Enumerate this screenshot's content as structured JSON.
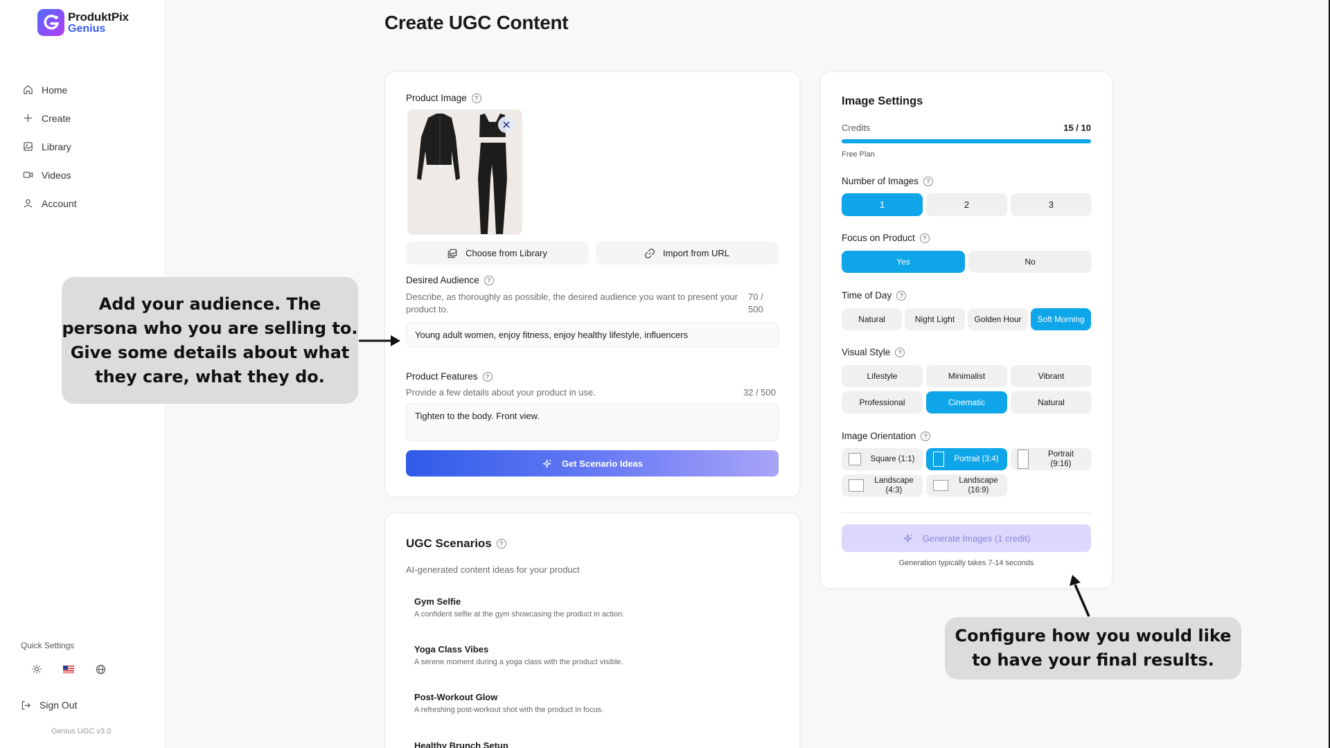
{
  "app": {
    "name": "ProduktPix",
    "subname": "Genius",
    "version": "Genius UGC v3.0"
  },
  "sidebar": {
    "items": [
      {
        "label": "Home",
        "icon": "home-icon"
      },
      {
        "label": "Create",
        "icon": "plus-icon"
      },
      {
        "label": "Library",
        "icon": "image-icon"
      },
      {
        "label": "Videos",
        "icon": "video-icon"
      },
      {
        "label": "Account",
        "icon": "user-icon"
      }
    ],
    "quick_settings_label": "Quick Settings",
    "sign_out": "Sign Out"
  },
  "page": {
    "title": "Create UGC Content"
  },
  "product_card": {
    "product_image_label": "Product Image",
    "choose_library": "Choose from Library",
    "import_url": "Import from URL",
    "audience_label": "Desired Audience",
    "audience_hint": "Describe, as thoroughly as possible, the desired audience you want to present your product to.",
    "audience_count_top": "70 /",
    "audience_count_bottom": "500",
    "audience_value": "Young adult women, enjoy fitness, enjoy healthy lifestyle, influencers",
    "features_label": "Product Features",
    "features_hint": "Provide a few details about your product in use.",
    "features_count": "32 / 500",
    "features_value": "Tighten to the body. Front view.",
    "scenario_button": "Get Scenario Ideas"
  },
  "scenarios_card": {
    "title": "UGC Scenarios",
    "subtitle": "AI-generated content ideas for your product",
    "items": [
      {
        "title": "Gym Selfie",
        "desc": "A confident selfie at the gym showcasing the product in action."
      },
      {
        "title": "Yoga Class Vibes",
        "desc": "A serene moment during a yoga class with the product visible."
      },
      {
        "title": "Post-Workout Glow",
        "desc": "A refreshing post-workout shot with the product in focus."
      },
      {
        "title": "Healthy Brunch Setup",
        "desc": ""
      }
    ]
  },
  "settings": {
    "title": "Image Settings",
    "credits_label": "Credits",
    "credits_value": "15 / 10",
    "credits_fill": 1.0,
    "plan": "Free Plan",
    "num_images_label": "Number of Images",
    "num_images": [
      "1",
      "2",
      "3"
    ],
    "focus_label": "Focus on Product",
    "focus": [
      "Yes",
      "No"
    ],
    "time_label": "Time of Day",
    "time": [
      "Natural",
      "Night Light",
      "Golden Hour",
      "Soft Morning"
    ],
    "style_label": "Visual Style",
    "style": [
      "Lifestyle",
      "Minimalist",
      "Vibrant",
      "Professional",
      "Cinematic",
      "Natural"
    ],
    "orientation_label": "Image Orientation",
    "orientation": {
      "square": "Square (1:1)",
      "portrait34": "Portrait (3:4)",
      "portrait916_a": "Portrait",
      "portrait916_b": "(9:16)",
      "landscape43_a": "Landscape",
      "landscape43_b": "(4:3)",
      "landscape169_a": "Landscape",
      "landscape169_b": "(16:9)"
    },
    "generate_button": "Generate Images (1 credit)",
    "generate_note": "Generation typically takes 7-14 seconds"
  },
  "callouts": {
    "audience": [
      "Add your audience. The",
      "persona who you are selling to.",
      "Give some details about what",
      "they care, what they do."
    ],
    "settings": [
      "Configure how you would like",
      "to have your final results."
    ]
  },
  "colors": {
    "accent": "#0ea5e9",
    "brand_blue": "#3d5cf5",
    "callout_bg": "#dcdcdc"
  }
}
